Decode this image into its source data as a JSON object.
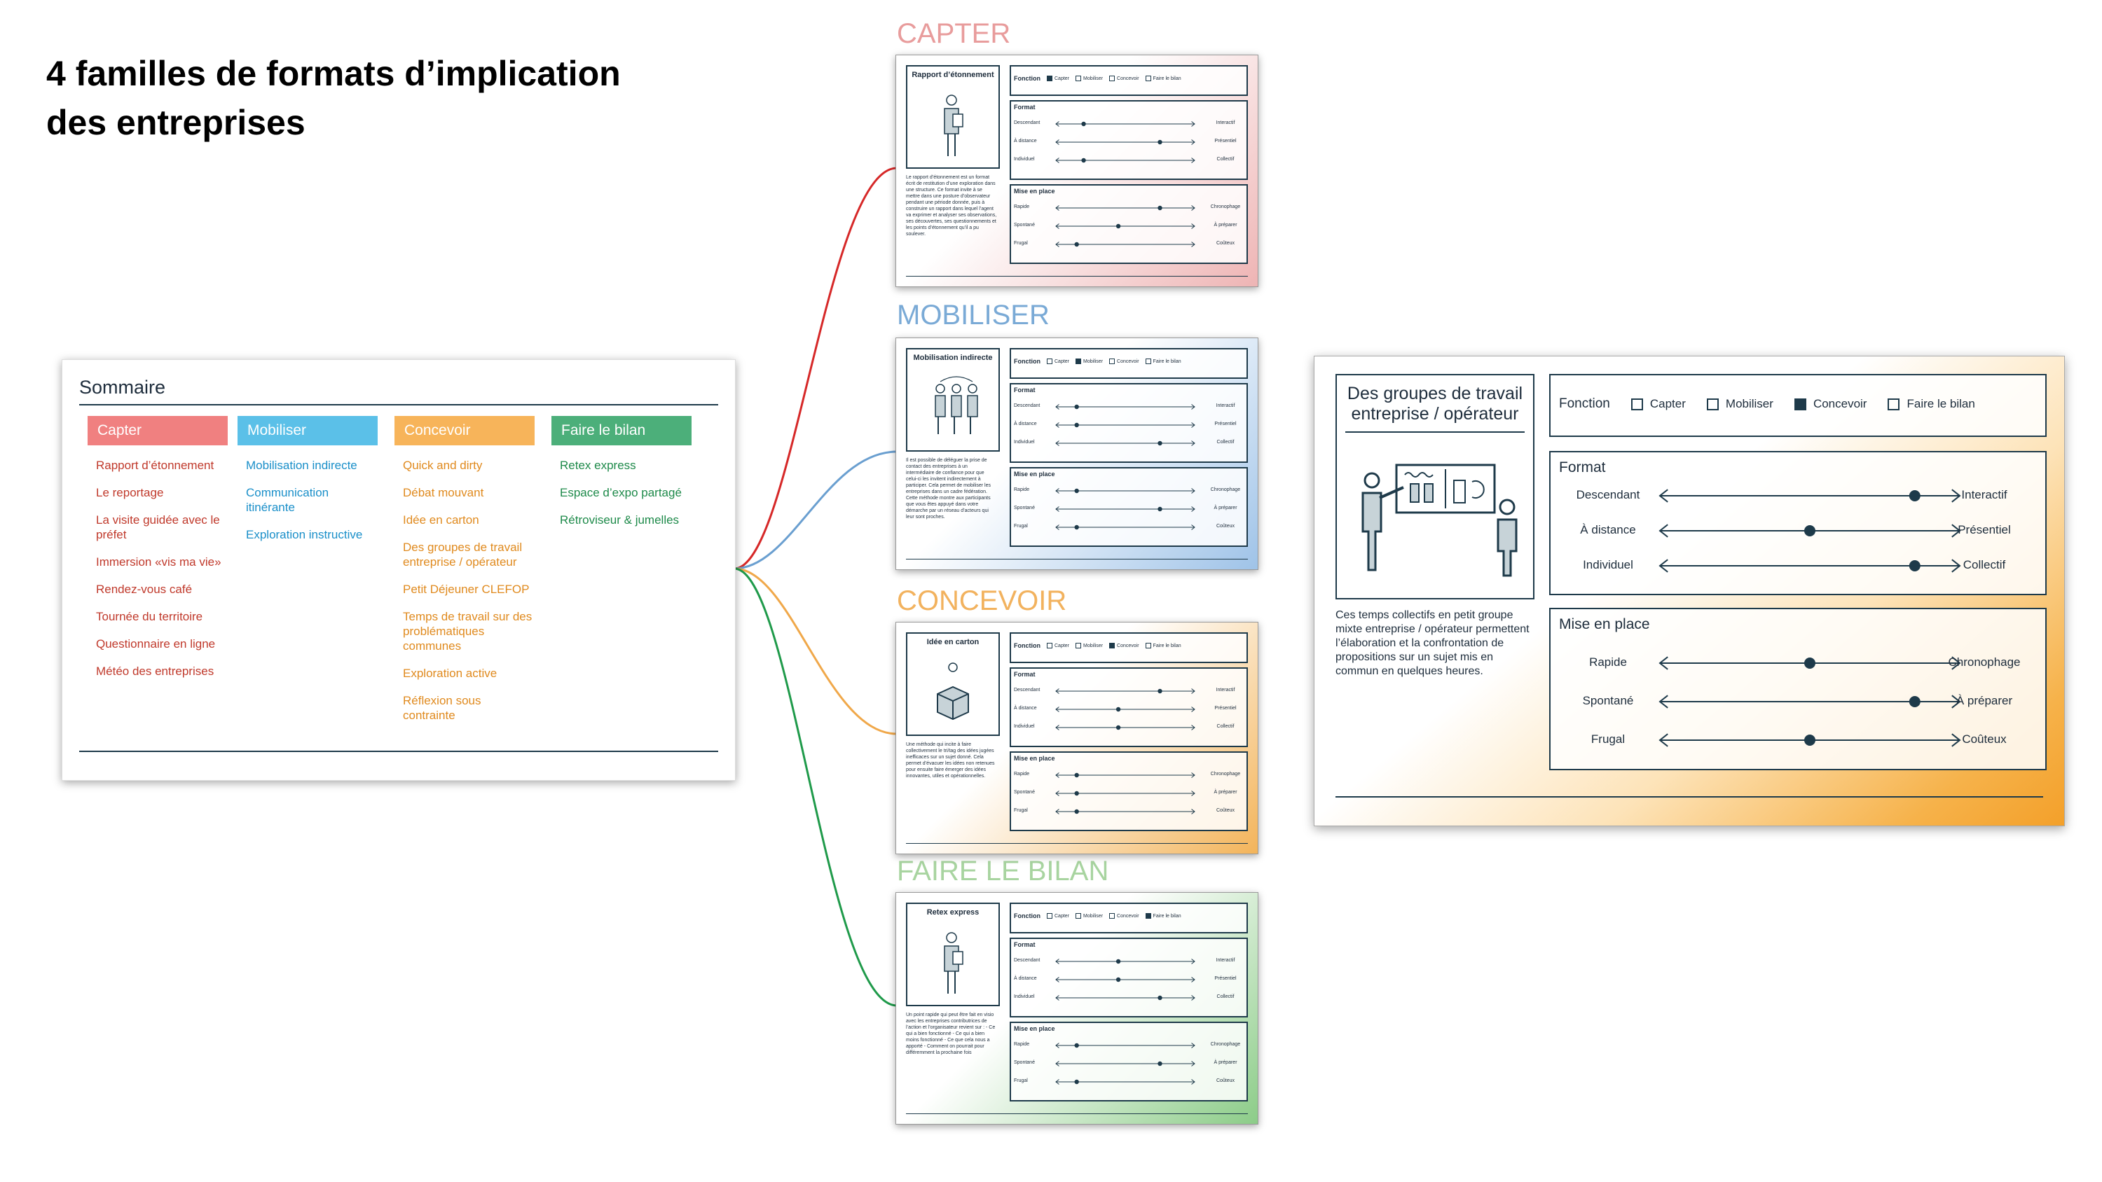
{
  "title": {
    "line1": "4 familles de formats d’implication",
    "line2": "des entreprises"
  },
  "sommaire": {
    "title": "Sommaire",
    "columns": [
      {
        "header": "Capter",
        "color": "#f08080",
        "text_color": "#c0392b",
        "items": [
          "Rapport d’étonnement",
          "Le reportage",
          "La visite guidée avec le préfet",
          "Immersion «vis ma vie»",
          "Rendez-vous café",
          "Tournée du territoire",
          "Questionnaire en ligne",
          "Météo des entreprises"
        ]
      },
      {
        "header": "Mobiliser",
        "color": "#5bc0e8",
        "text_color": "#1a8fc9",
        "items": [
          "Mobilisation indirecte",
          "Communication itinérante",
          "Exploration instructive"
        ]
      },
      {
        "header": "Concevoir",
        "color": "#f7b45a",
        "text_color": "#e08a1e",
        "items": [
          "Quick and dirty",
          "Débat mouvant",
          "Idée en carton",
          "Des groupes de travail entreprise / opérateur",
          "Petit Déjeuner CLEFOP",
          "Temps de travail sur des problématiques communes",
          "Exploration active",
          "Réflexion sous contrainte"
        ]
      },
      {
        "header": "Faire le bilan",
        "color": "#4caf7a",
        "text_color": "#1e8a4a",
        "items": [
          "Retex express",
          "Espace d’expo partagé",
          "Rétroviseur & jumelles"
        ]
      }
    ]
  },
  "families": [
    {
      "label": "CAPTER",
      "label_color": "#e89c9c",
      "connector_color": "#d62828",
      "tint": "#eeb4b4",
      "card": {
        "name": "Rapport d’étonnement",
        "icon": "person-reading-icon",
        "function_selected": "Capter",
        "desc": "Le rapport d’étonnement est un format écrit de restitution d’une exploration dans une structure. Ce format invite à se mettre dans une posture d’observateur pendant une période donnée, puis à construire un rapport dans lequel l’agent va exprimer et analyser ses observations, ses découvertes, ses questionnements et les points d’étonnement qu’il a pu soulever.",
        "format": [
          0.2,
          0.75,
          0.2
        ],
        "mise": [
          0.75,
          0.45,
          0.15
        ]
      }
    },
    {
      "label": "MOBILISER",
      "label_color": "#7aaad6",
      "connector_color": "#6a9fd0",
      "tint": "#9fc3e8",
      "card": {
        "name": "Mobilisation indirecte",
        "icon": "three-people-icon",
        "function_selected": "Mobiliser",
        "desc": "Il est possible de déléguer la prise de contact des entreprises à un intermédiaire de confiance pour que celui-ci les invitent indirectement à participer. Cela permet de mobiliser les entreprises dans un cadre fédération. Cette méthode montre aux participants que vous êtes appuyé dans votre démarche par un réseau d’acteurs qui leur sont proches.",
        "format": [
          0.15,
          0.15,
          0.75
        ],
        "mise": [
          0.15,
          0.75,
          0.15
        ]
      }
    },
    {
      "label": "CONCEVOIR",
      "label_color": "#f2b25e",
      "connector_color": "#f0a84a",
      "tint": "#f3b45a",
      "card": {
        "name": "Idée en carton",
        "icon": "cardboard-box-icon",
        "function_selected": "Concevoir",
        "desc": "Une méthode qui incite à faire collectivement le tri/tag des idées jugées inefficaces sur un sujet donné. Cela permet d’évacuer les idées non retenues pour ensuite faire émerger des idées innovantes, utiles et opérationnelles.",
        "format": [
          0.75,
          0.45,
          0.45
        ],
        "mise": [
          0.15,
          0.15,
          0.15
        ]
      }
    },
    {
      "label": "FAIRE LE BILAN",
      "label_color": "#a8d4a0",
      "connector_color": "#1f9a4a",
      "tint": "#8ccc88",
      "card": {
        "name": "Retex express",
        "icon": "person-reading-icon",
        "function_selected": "Faire le bilan",
        "desc": "Un point rapide qui peut être fait en visio avec les entreprises contributrices de l’action et l’organisateur revient sur : - Ce qui a bien fonctionné - Ce qui a bien moins fonctionné - Ce que cela nous a apporté - Comment on pourrait pour différemment la prochaine fois",
        "format": [
          0.45,
          0.45,
          0.75
        ],
        "mise": [
          0.15,
          0.75,
          0.15
        ]
      }
    }
  ],
  "card_labels": {
    "fonction": "Fonction",
    "functions": [
      "Capter",
      "Mobiliser",
      "Concevoir",
      "Faire le bilan"
    ],
    "format": "Format",
    "format_rows": [
      [
        "Descendant",
        "Interactif"
      ],
      [
        "À distance",
        "Présentiel"
      ],
      [
        "Individuel",
        "Collectif"
      ]
    ],
    "mise": "Mise en place",
    "mise_rows": [
      [
        "Rapide",
        "Chronophage"
      ],
      [
        "Spontané",
        "À préparer"
      ],
      [
        "Frugal",
        "Coûteux"
      ]
    ]
  },
  "big_card": {
    "name": "Des groupes de travail entreprise / opérateur",
    "icon": "presentation-board-icon",
    "function_selected": "Concevoir",
    "desc": "Ces temps collectifs en petit groupe mixte entreprise / opérateur permettent l’élaboration et la confrontation de propositions sur un sujet mis en commun en quelques heures.",
    "format": [
      0.85,
      0.5,
      0.85
    ],
    "mise": [
      0.5,
      0.85,
      0.5
    ]
  }
}
